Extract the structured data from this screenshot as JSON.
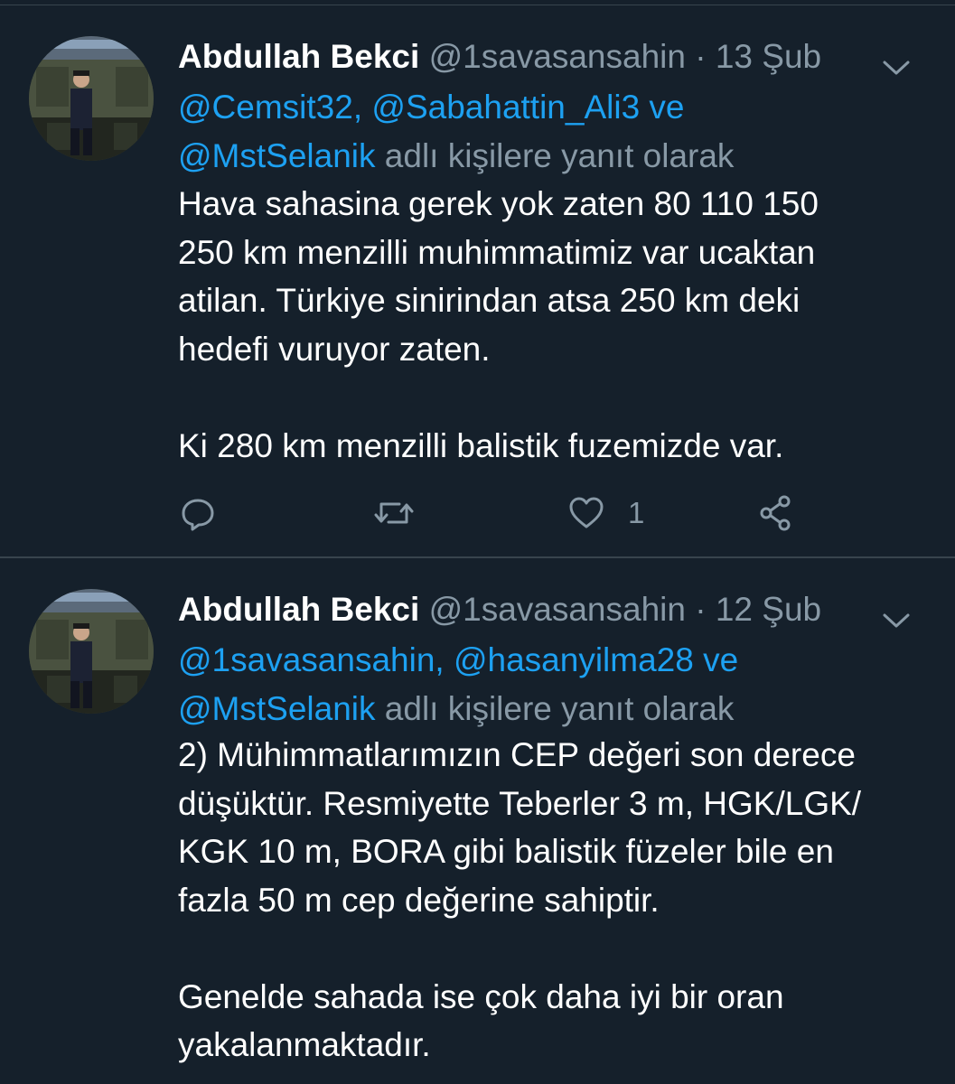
{
  "colors": {
    "background": "#15202b",
    "text": "#ffffff",
    "secondary": "#8899a6",
    "link": "#1da1f2",
    "divider": "#38444d"
  },
  "tweets": [
    {
      "author_name": "Abdullah Bekci",
      "handle": "@1savasansahin",
      "separator": "·",
      "date": "13 Şub",
      "reply_mentions_line1": "@Cemsit32, @Sabahattin_Ali3 ve",
      "reply_mention_last": "@MstSelanik",
      "reply_suffix": " adlı kişilere yanıt olarak",
      "text": "Hava sahasina gerek yok zaten 80 110 150\n250 km menzilli muhimmatimiz var ucaktan\natilan. Türkiye sinirindan atsa 250 km deki\nhedefi vuruyor zaten.\n\nKi 280 km menzilli balistik fuzemizde var.",
      "like_count": "1",
      "icons": [
        "reply-icon",
        "retweet-icon",
        "heart-icon",
        "share-icon"
      ]
    },
    {
      "author_name": "Abdullah Bekci",
      "handle": "@1savasansahin",
      "separator": "·",
      "date": "12 Şub",
      "reply_mentions_line1": "@1savasansahin, @hasanyilma28 ve",
      "reply_mention_last": "@MstSelanik",
      "reply_suffix": " adlı kişilere yanıt olarak",
      "text": "2) Mühimmatlarımızın CEP değeri son derece\ndüşüktür. Resmiyette Teberler 3 m, HGK/LGK/\nKGK 10 m, BORA gibi balistik füzeler bile en\nfazla 50 m cep değerine sahiptir.\n\nGenelde sahada ise çok daha iyi bir oran\nyakalanmaktadır."
    }
  ]
}
